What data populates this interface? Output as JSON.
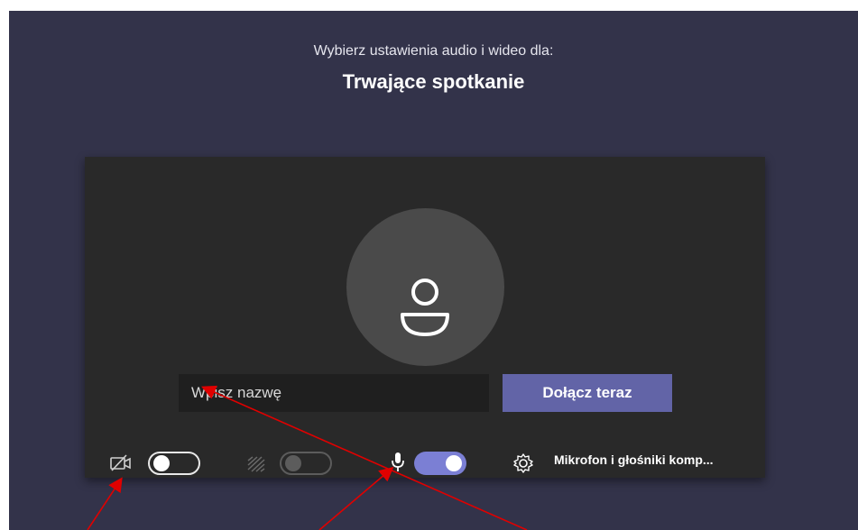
{
  "header": {
    "subtitle": "Wybierz ustawienia audio i wideo dla:",
    "title": "Trwające spotkanie"
  },
  "prejoin": {
    "name_input": {
      "placeholder": "Wpisz nazwę",
      "value": ""
    },
    "join_button": {
      "label": "Dołącz teraz"
    },
    "camera_toggle": {
      "state": "off"
    },
    "background_blur_toggle": {
      "state": "disabled"
    },
    "microphone_toggle": {
      "state": "on"
    },
    "device_settings": {
      "label": "Mikrofon i głośniki komp..."
    }
  },
  "icons": [
    "camera-off-icon",
    "background-effects-icon",
    "microphone-icon",
    "gear-icon",
    "person-icon"
  ],
  "colors": {
    "frame_bg": "#33334a",
    "panel_bg": "#292929",
    "accent": "#6264a7",
    "toggle_on": "#7b7fd4",
    "annotation_arrow": "#e00000"
  }
}
